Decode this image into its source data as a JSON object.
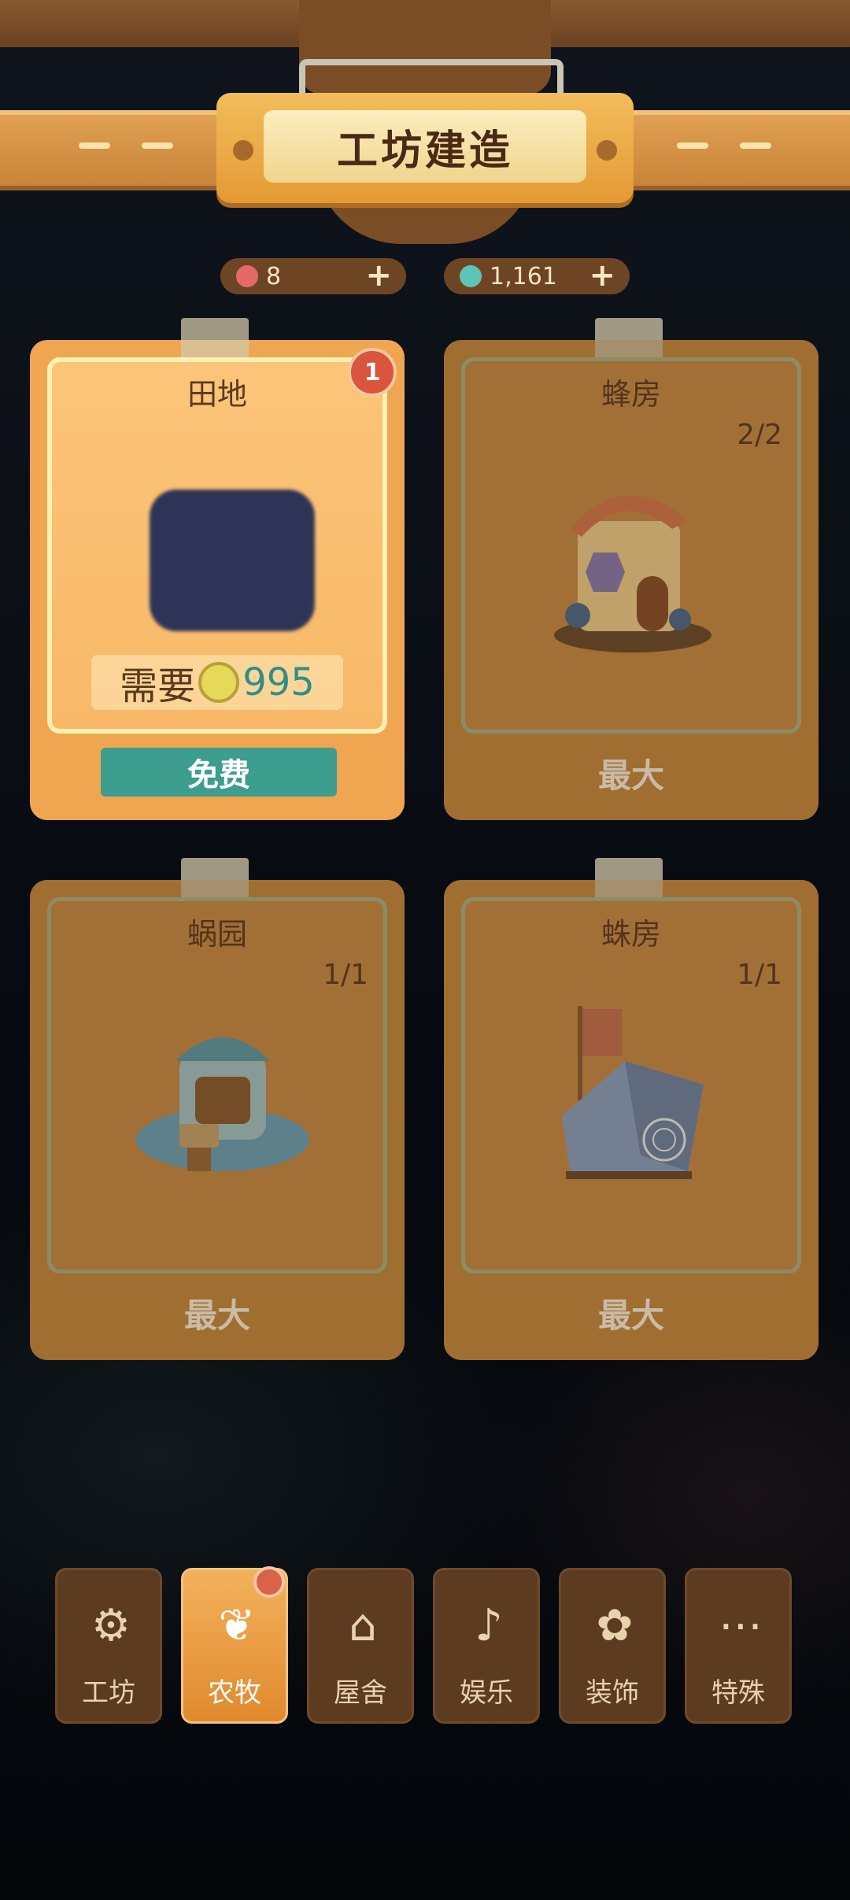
{
  "header": {
    "title": "工坊建造"
  },
  "currencies": [
    {
      "name": "pig-token",
      "value": "8",
      "color": "#e46a6a"
    },
    {
      "name": "star-gem",
      "value": "1,161",
      "color": "#5ec4b8"
    }
  ],
  "cards": [
    {
      "name": "田地",
      "badge": "1",
      "requirement_label": "需要",
      "requirement_value": "995",
      "action": "免费",
      "active": true
    },
    {
      "name": "蜂房",
      "count": "2/2",
      "status": "最大"
    },
    {
      "name": "蜗园",
      "count": "1/1",
      "status": "最大"
    },
    {
      "name": "蛛房",
      "count": "1/1",
      "status": "最大"
    }
  ],
  "nav": [
    {
      "label": "工坊",
      "icon": "gear-house-icon"
    },
    {
      "label": "农牧",
      "icon": "sprout-icon",
      "active": true
    },
    {
      "label": "屋舍",
      "icon": "mushroom-house-icon"
    },
    {
      "label": "娱乐",
      "icon": "bell-icon"
    },
    {
      "label": "装饰",
      "icon": "flower-lamp-icon"
    },
    {
      "label": "特殊",
      "icon": "more-icon"
    }
  ],
  "colors": {
    "accent": "#f0a650",
    "button_green": "#3d9d8f",
    "badge_red": "#d9553e"
  }
}
